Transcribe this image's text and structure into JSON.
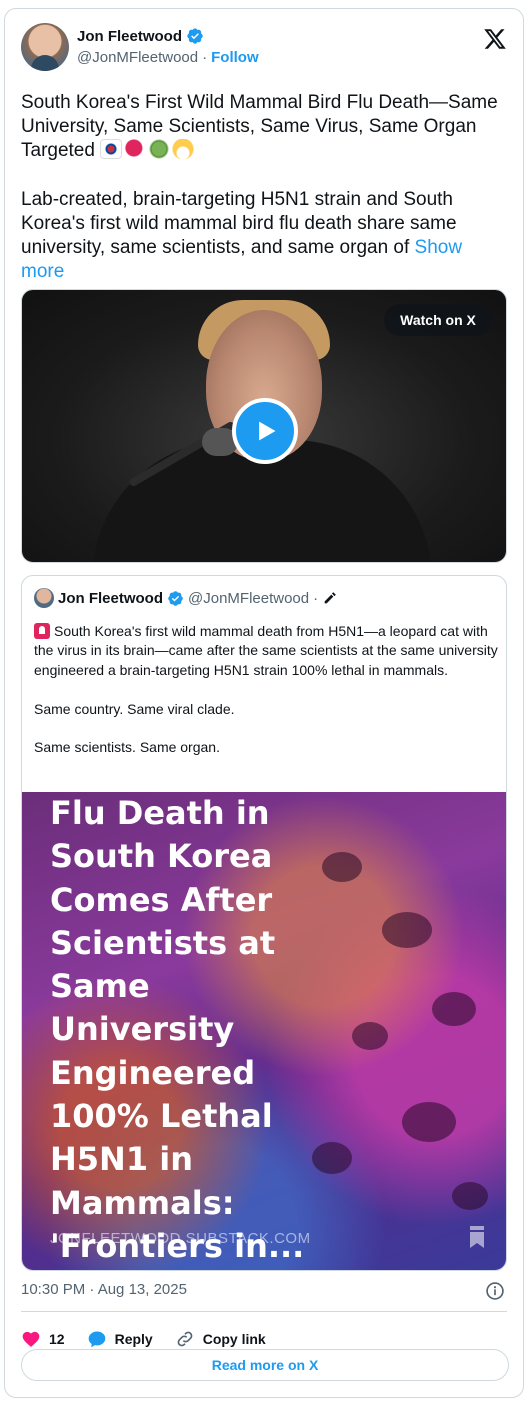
{
  "author": {
    "name": "Jon Fleetwood",
    "handle": "@JonMFleetwood",
    "separator": "·",
    "follow_label": "Follow"
  },
  "tweet": {
    "text": "South Korea's First Wild Mammal Bird Flu Death—Same University, Same Scientists, Same Virus, Same Organ Targeted ",
    "body": "Lab-created, brain-targeting H5N1 strain and South Korea's first wild mammal bird flu death share same university, same scientists, and same organ of ",
    "show_more": "Show more",
    "emojis": [
      "south-korea-flag",
      "red-bird",
      "microbe",
      "face-with-medical-mask"
    ]
  },
  "video": {
    "watch_label": "Watch on X",
    "play_icon": "play-icon"
  },
  "quote": {
    "author_name": "Jon Fleetwood",
    "author_handle": "@JonMFleetwood",
    "separator": "·",
    "text_line1": "South Korea's first wild mammal death from H5N1—a leopard cat with the virus in its brain—came after the same scientists at the same university engineered a brain-targeting H5N1 strain 100% lethal in mammals.",
    "text_line2": "Same country. Same viral clade.",
    "text_line3": "Same scientists. Same organ.",
    "image_title": "Flu Death in\nSouth Korea\nComes After\nScientists at\nSame\nUniversity\nEngineered\n100% Lethal\nH5N1 in\nMammals:\n'Frontiers in...",
    "image_domain": "JONFLEETWOOD.SUBSTACK.COM"
  },
  "meta": {
    "timestamp": "10:30 PM · Aug 13, 2025"
  },
  "actions": {
    "like_count": "12",
    "reply_label": "Reply",
    "copy_label": "Copy link",
    "read_more": "Read more on X"
  },
  "colors": {
    "accent": "#1d9bf0",
    "like": "#f91880",
    "text": "#0f1419",
    "secondary": "#536471"
  }
}
